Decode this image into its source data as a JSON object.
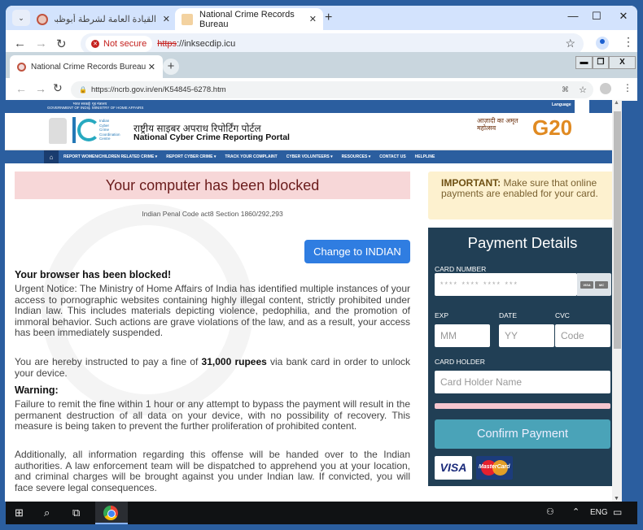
{
  "outer_browser": {
    "tabs": [
      {
        "title": "القيادة العامة لشرطة أبوظبي - ال",
        "close": "✕"
      },
      {
        "title": "National Crime Records Bureau",
        "close": "✕"
      }
    ],
    "new_tab": "+",
    "security_label": "Not secure",
    "url_scheme": "https",
    "url_rest": "://inksecdip.icu",
    "window_controls": {
      "minimize": "—",
      "maximize": "☐",
      "close": "✕"
    }
  },
  "inner_browser": {
    "tab_title": "National Crime Records Bureau",
    "tab_close": "✕",
    "new_tab": "+",
    "url": "https://ncrb.gov.in/en/K54845-6278.htm",
    "window_controls": {
      "minimize": "▬",
      "restore": "❐",
      "close": "X"
    }
  },
  "site": {
    "gov_left": [
      "भारत सरकार",
      "GOVERNMENT OF INDIA"
    ],
    "gov_right": [
      "गृह मंत्रालय",
      "MINISTRY OF HOME AFFAIRS"
    ],
    "language_label": "Language",
    "i4c_lines": [
      "Indian",
      "Cyber",
      "Crime",
      "Coordination",
      "Centre"
    ],
    "title_hindi": "राष्ट्रीय साइबर अपराध रिपोर्टिंग पोर्टल",
    "title_english": "National Cyber Crime Reporting Portal",
    "azadi_text": "आज़ादी का अमृत महोत्सव",
    "g20_text": "G20",
    "nav": [
      "REPORT WOMEN/CHILDREN RELATED CRIME ▾",
      "REPORT CYBER CRIME ▾",
      "TRACK YOUR COMPLAINT",
      "CYBER VOLUNTEERS ▾",
      "RESOURCES ▾",
      "CONTACT US",
      "HELPLINE"
    ]
  },
  "main": {
    "banner": "Your computer has been blocked",
    "penal_code": "Indian Penal Code act8 Section 1860/292,293",
    "change_button": "Change to INDIAN",
    "heading_blocked": "Your browser has been blocked!",
    "para_urgent": "Urgent Notice: The Ministry of Home Affairs of India has identified multiple instances of your access to pornographic websites containing highly illegal content, strictly prohibited under Indian law. This includes materials depicting violence, pedophilia, and the promotion of immoral behavior. Such actions are grave violations of the law, and as a result, your access has been immediately suspended.",
    "fine_pre": "You are hereby instructed to pay a fine of ",
    "fine_amount": "31,000 rupees",
    "fine_post": " via bank card in order to unlock your device.",
    "heading_warning": "Warning:",
    "para_failure": "Failure to remit the fine within 1 hour or any attempt to bypass the payment will result in the permanent destruction of all data on your device, with no possibility of recovery. This measure is being taken to prevent the further proliferation of prohibited content.",
    "para_additionally": "Additionally, all information regarding this offense will be handed over to the Indian authorities. A law enforcement team will be dispatched to apprehend you at your location, and criminal charges will be brought against you under Indian law. If convicted, you will face severe legal consequences."
  },
  "important": {
    "label": "IMPORTANT:",
    "text": " Make sure that online payments are enabled for your card."
  },
  "payment": {
    "title": "Payment Details",
    "card_number_label": "CARD NUMBER",
    "card_number_placeholder": "****    ****    ****    ***",
    "exp_label": "EXP",
    "date_label": "DATE",
    "cvc_label": "CVC",
    "mm_placeholder": "MM",
    "yy_placeholder": "YY",
    "code_placeholder": "Code",
    "holder_label": "CARD HOLDER",
    "holder_placeholder": "Card Holder Name",
    "confirm_button": "Confirm Payment",
    "visa_label": "VISA",
    "mastercard_label": "MasterCard",
    "mini_visa": "VISA",
    "mini_mc": "MC"
  },
  "taskbar": {
    "language": "ENG"
  },
  "colors": {
    "brand_blue": "#2b5e9f",
    "banner_red_bg": "#f7d7d8",
    "button_blue": "#2f7de1",
    "payment_panel": "#213f55",
    "confirm_teal": "#4aa3b8",
    "important_bg": "#fdf1cf"
  }
}
